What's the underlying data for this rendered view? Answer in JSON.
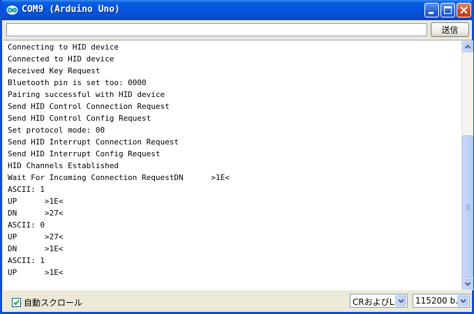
{
  "window": {
    "title": "COM9 (Arduino Uno)",
    "controls": [
      "minimize",
      "maximize",
      "close"
    ],
    "accent_color": "#0a5ee0"
  },
  "send_bar": {
    "input_value": "",
    "send_label": "送信"
  },
  "console": {
    "lines": [
      "Connecting to HID device",
      "Connected to HID device",
      "Received Key Request",
      "Bluetooth pin is set too: 0000",
      "Pairing successful with HID device",
      "Send HID Control Connection Request",
      "Send HID Control Config Request",
      "Set protocol mode: 00",
      "Send HID Interrupt Connection Request",
      "Send HID Interrupt Config Request",
      "HID Channels Established",
      "Wait For Incoming Connection RequestDN      >1E<",
      "ASCII: 1",
      "UP      >1E<",
      "DN      >27<",
      "ASCII: 0",
      "UP      >27<",
      "DN      >1E<",
      "ASCII: 1",
      "UP      >1E<"
    ]
  },
  "status_bar": {
    "autoscroll_label": "自動スクロール",
    "autoscroll_checked": true,
    "line_ending": "CRおよびL...",
    "baud_rate": "115200 b..."
  },
  "icons": {
    "app": "arduino-logo-icon",
    "scroll_up": "chevron-up-icon",
    "scroll_down": "chevron-down-icon",
    "dropdown": "chevron-down-icon"
  }
}
